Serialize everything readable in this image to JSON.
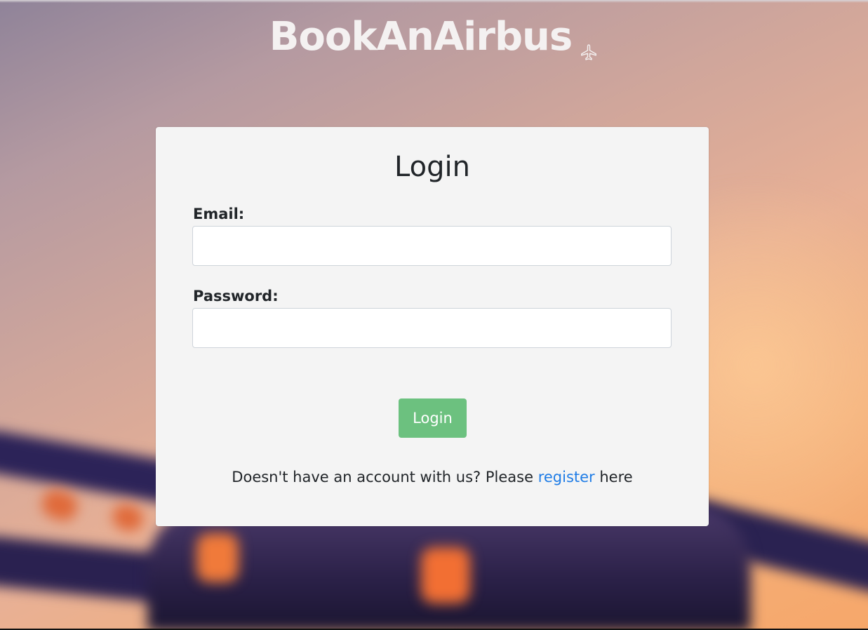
{
  "header": {
    "brand": "BookAnAirbus",
    "brand_icon": "airplane-icon"
  },
  "login_card": {
    "title": "Login",
    "email_label": "Email:",
    "email_value": "",
    "password_label": "Password:",
    "password_value": "",
    "submit_label": "Login",
    "register_prefix": "Doesn't have an account with us? Please ",
    "register_link": "register",
    "register_suffix": " here"
  },
  "colors": {
    "button": "#6cc17f",
    "link": "#1e7ce6",
    "card": "#f4f4f4"
  }
}
